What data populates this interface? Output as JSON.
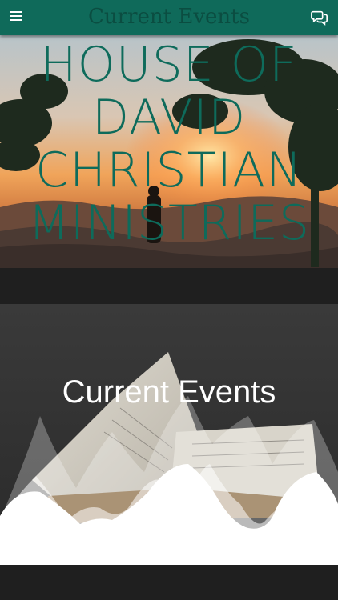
{
  "appbar": {
    "title": "Current Events",
    "menu_icon": "hamburger-menu-icon",
    "chat_icon": "chat-bubbles-icon",
    "background": "#0f6a5a"
  },
  "hero": {
    "title_lines": [
      "HOUSE OF",
      "DAVID",
      "CHRISTIAN",
      "MINISTRIES"
    ],
    "text_color": "#0e6b5b"
  },
  "section": {
    "title": "Current Events"
  }
}
